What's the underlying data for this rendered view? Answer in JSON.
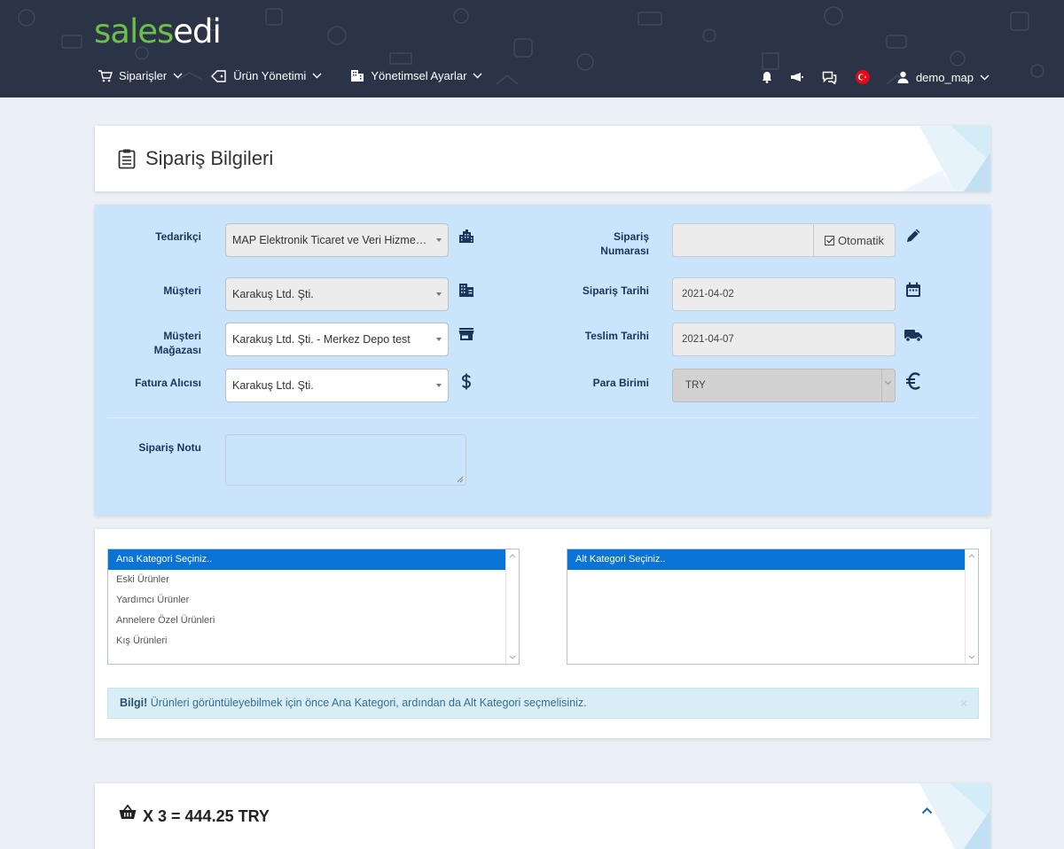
{
  "brand": {
    "part1": "sales",
    "part2": "edi"
  },
  "nav": {
    "items": [
      {
        "label": "Siparişler",
        "icon": "cart-icon"
      },
      {
        "label": "Ürün Yönetimi",
        "icon": "tag-icon"
      },
      {
        "label": "Yönetimsel Ayarlar",
        "icon": "building-icon"
      }
    ],
    "user": "demo_map"
  },
  "page": {
    "title": "Sipariş Bilgileri"
  },
  "form": {
    "supplier": {
      "label": "Tedarikçi",
      "value": "MAP Elektronik Ticaret ve Veri Hizmetleri"
    },
    "customer": {
      "label": "Müşteri",
      "value": "Karakuş Ltd. Şti."
    },
    "store": {
      "label_1": "Müşteri",
      "label_2": "Mağazası",
      "value": "Karakuş Ltd. Şti. - Merkez Depo test"
    },
    "invoice": {
      "label": "Fatura Alıcısı",
      "value": "Karakuş Ltd. Şti."
    },
    "order_no": {
      "label_1": "Sipariş",
      "label_2": "Numarası",
      "value": "",
      "auto_label": "Otomatik",
      "auto_checked": true
    },
    "order_date": {
      "label": "Sipariş Tarihi",
      "value": "2021-04-02"
    },
    "delivery_date": {
      "label": "Teslim Tarihi",
      "value": "2021-04-07"
    },
    "currency": {
      "label": "Para Birimi",
      "value": "TRY"
    },
    "note": {
      "label": "Sipariş Notu",
      "value": ""
    }
  },
  "categories": {
    "main": [
      "Ana Kategori Seçiniz..",
      "Eski Ürünler",
      "Yardımcı Ürünler",
      "Annelere Özel Ürünleri",
      "Kış Ürünleri"
    ],
    "main_selected": 0,
    "sub": [
      "Alt Kategori Seçiniz.."
    ],
    "sub_selected": 0
  },
  "alert": {
    "strong": "Bilgi!",
    "text": " Ürünleri görüntüleyebilmek için önce Ana Kategori, ardından da Alt Kategori seçmelisiniz.",
    "close": "×"
  },
  "basket": {
    "summary": "X 3 = 444.25 TRY"
  },
  "colors": {
    "header": "#2b3446",
    "brand_green": "#6cc04a",
    "form_bg": "#cae4fc",
    "list_selected": "#0a73d6",
    "icon_blue": "#1e3358"
  }
}
